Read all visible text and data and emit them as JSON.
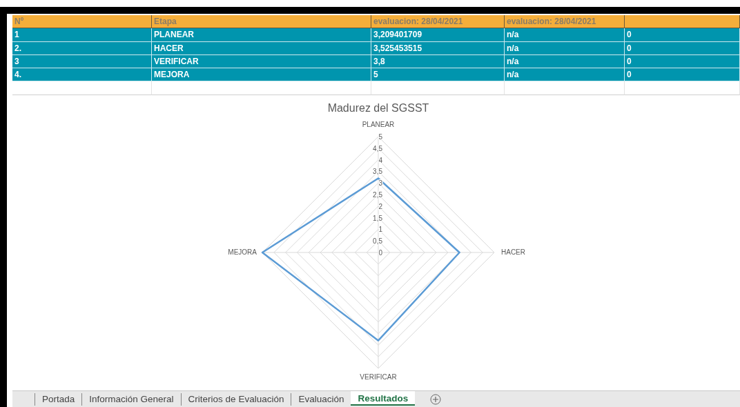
{
  "table": {
    "columns": [
      "Nº",
      "Etapa",
      "evaluacion: 28/04/2021",
      "evaluacion: 28/04/2021"
    ],
    "rows": [
      [
        "1",
        "PLANEAR",
        "3,209401709",
        "n/a",
        "0"
      ],
      [
        "2.",
        "HACER",
        "3,525453515",
        "n/a",
        "0"
      ],
      [
        "3",
        "VERIFICAR",
        "3,8",
        "n/a",
        "0"
      ],
      [
        "4.",
        "MEJORA",
        "5",
        "n/a",
        "0"
      ]
    ]
  },
  "chart": {
    "chart_data": {
      "type": "radar",
      "title": "Madurez del SGSST",
      "categories": [
        "PLANEAR",
        "HACER",
        "VERIFICAR",
        "MEJORA"
      ],
      "series": [
        {
          "color": "#5b9bd5",
          "values": [
            3.2,
            3.5,
            3.8,
            5
          ]
        }
      ],
      "ylim": [
        0,
        5
      ],
      "yticks": [
        0,
        {
          "value": 0.5,
          "label": "0,5"
        },
        1,
        {
          "value": 1.5,
          "label": "1,5"
        },
        2,
        {
          "value": 2.5,
          "label": "2,5"
        },
        3,
        {
          "value": 3.5,
          "label": "3,5"
        },
        4,
        {
          "value": 4.5,
          "label": "4,5"
        },
        5
      ]
    }
  },
  "sheet_tabs": [
    {
      "label": "Portada",
      "selected": false
    },
    {
      "label": "Información General",
      "selected": false
    },
    {
      "label": "Criterios de Evaluación",
      "selected": false
    },
    {
      "label": "Evaluación",
      "selected": false
    },
    {
      "label": "Resultados",
      "selected": true
    }
  ]
}
